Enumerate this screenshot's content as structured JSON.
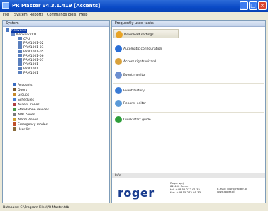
{
  "window": {
    "title": "PR Master v4.3.1.419 [Accents]"
  },
  "menu": {
    "items": [
      "File",
      "System",
      "Reports",
      "Commands",
      "Tools",
      "Help"
    ]
  },
  "left_panel": {
    "header": "System",
    "tree": [
      {
        "label": "Networks",
        "level": 0
      },
      {
        "label": "Network 001",
        "level": 1
      },
      {
        "label": "CPU",
        "level": 2
      },
      {
        "label": "PRM1001-02",
        "level": 2
      },
      {
        "label": "PRM1001-03",
        "level": 2
      },
      {
        "label": "PRM1001-05",
        "level": 2
      },
      {
        "label": "PRM1001-06",
        "level": 2
      },
      {
        "label": "PRM1001-07",
        "level": 2
      },
      {
        "label": "PRM1001",
        "level": 2
      },
      {
        "label": "PRM1001",
        "level": 2
      },
      {
        "label": "PRM1001",
        "level": 2
      },
      {
        "label": "Accounts",
        "level": 0
      },
      {
        "label": "Doors",
        "level": 0
      },
      {
        "label": "Groups",
        "level": 0
      },
      {
        "label": "Schedules",
        "level": 0
      },
      {
        "label": "Access Zones",
        "level": 0
      },
      {
        "label": "Standalone devices",
        "level": 0
      },
      {
        "label": "APB Zones",
        "level": 0
      },
      {
        "label": "Alarm Zones",
        "level": 0
      },
      {
        "label": "Emergency modes",
        "level": 0
      },
      {
        "label": "User list",
        "level": 0
      }
    ]
  },
  "right_panel": {
    "header": "Frequently used tasks",
    "tasks": [
      {
        "label": "Download settings",
        "color": "#e8a426",
        "icon": "download-icon"
      },
      {
        "label": "Automatic configuration",
        "color": "#2b6fd6",
        "icon": "config-icon"
      },
      {
        "label": "Access rights wizard",
        "color": "#d9a13a",
        "icon": "wizard-icon"
      },
      {
        "label": "Event monitor",
        "color": "#6c8fd0",
        "icon": "monitor-icon"
      },
      {
        "label": "Event history",
        "color": "#3a7bd5",
        "icon": "history-icon"
      },
      {
        "label": "Reports editor",
        "color": "#5a9ad8",
        "icon": "reports-icon"
      },
      {
        "label": "Quick start guide",
        "color": "#2e9e3a",
        "icon": "guide-icon"
      }
    ],
    "info_header": "Info",
    "brand": "roger",
    "info_lines_a": [
      "Roger sp.j.",
      "82-400 Sztum",
      "tel: +48 55 272 01 32",
      "fax: +48 55 272 01 33"
    ],
    "info_lines_b": [
      "e-mail: biuro@roger.pl",
      "www.roger.pl"
    ]
  },
  "status": {
    "text": "Database: C:\\Program Files\\PR Master.fdb"
  }
}
